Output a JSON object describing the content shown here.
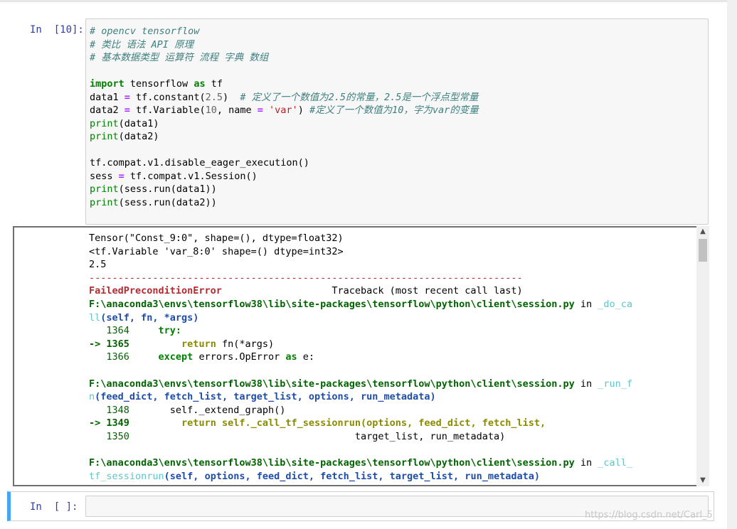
{
  "cell1": {
    "prompt": "In  [10]:",
    "lines": {
      "l1": "# opencv tensorflow",
      "l2": "# 类比 语法 API 原理",
      "l3": "# 基本数据类型 运算符 流程 字典 数组",
      "l5_kw1": "import",
      "l5_mod": " tensorflow ",
      "l5_kw2": "as",
      "l5_alias": " tf",
      "l6_a": "data1 ",
      "l6_eq": "=",
      "l6_b": " tf.constant(",
      "l6_num": "2.5",
      "l6_c": ")  ",
      "l6_cm": "# 定义了一个数值为2.5的常量，2.5是一个浮点型常量",
      "l7_a": "data2 ",
      "l7_eq": "=",
      "l7_b": " tf.Variable(",
      "l7_num": "10",
      "l7_c": ", name ",
      "l7_eq2": "=",
      "l7_d": " ",
      "l7_str": "'var'",
      "l7_e": ") ",
      "l7_cm": "#定义了一个数值为10，字为var的变量",
      "l8_fn": "print",
      "l8_arg": "(data1)",
      "l9_fn": "print",
      "l9_arg": "(data2)",
      "l11": "tf.compat.v1.disable_eager_execution()",
      "l12_a": "sess ",
      "l12_eq": "=",
      "l12_b": " tf.compat.v1.Session()",
      "l13_fn": "print",
      "l13_arg": "(sess.run(data1))",
      "l14_fn": "print",
      "l14_arg": "(sess.run(data2))"
    }
  },
  "output": {
    "o1": "Tensor(\"Const_9:0\", shape=(), dtype=float32)",
    "o2": "<tf.Variable 'var_8:0' shape=() dtype=int32>",
    "o3": "2.5",
    "o4": "---------------------------------------------------------------------------",
    "o5_err": "FailedPreconditionError",
    "o5_tb": "                   Traceback (most recent call last)",
    "o6_path": "F:\\anaconda3\\envs\\tensorflow38\\lib\\site-packages\\tensorflow\\python\\client\\session.py",
    "o6_in": " in ",
    "o6_fn": "_do_ca",
    "o7_fn": "ll",
    "o7_args": "(self, fn, *args)",
    "o8_no": "   1364",
    "o8_kw": "     try:",
    "o9_arrow": "-> 1365",
    "o9_kw": "         return",
    "o9_rest": " fn(*args)",
    "o10_no": "   1366",
    "o10_kw": "     except",
    "o10_mid": " errors.OpError ",
    "o10_kw2": "as",
    "o10_end": " e:",
    "o12_path": "F:\\anaconda3\\envs\\tensorflow38\\lib\\site-packages\\tensorflow\\python\\client\\session.py",
    "o12_in": " in ",
    "o12_fn": "_run_f",
    "o13_fn": "n",
    "o13_args": "(feed_dict, fetch_list, target_list, options, run_metadata)",
    "o14_no": "   1348",
    "o14_rest": "       self._extend_graph()",
    "o15_arrow": "-> 1349",
    "o15_rest": "         return self._call_tf_sessionrun(options, feed_dict, fetch_list,",
    "o16_no": "   1350",
    "o16_rest": "                                       target_list, run_metadata)",
    "o18_path": "F:\\anaconda3\\envs\\tensorflow38\\lib\\site-packages\\tensorflow\\python\\client\\session.py",
    "o18_in": " in ",
    "o18_fn": "_call_",
    "o19_fn": "tf_sessionrun",
    "o19_args": "(self, options, feed_dict, fetch_list, target_list, run_metadata)"
  },
  "scroll": {
    "up": "▲",
    "down": "▼"
  },
  "cell2": {
    "prompt": "In  [ ]:"
  },
  "watermark": "https://blog.csdn.net/Carl_5"
}
